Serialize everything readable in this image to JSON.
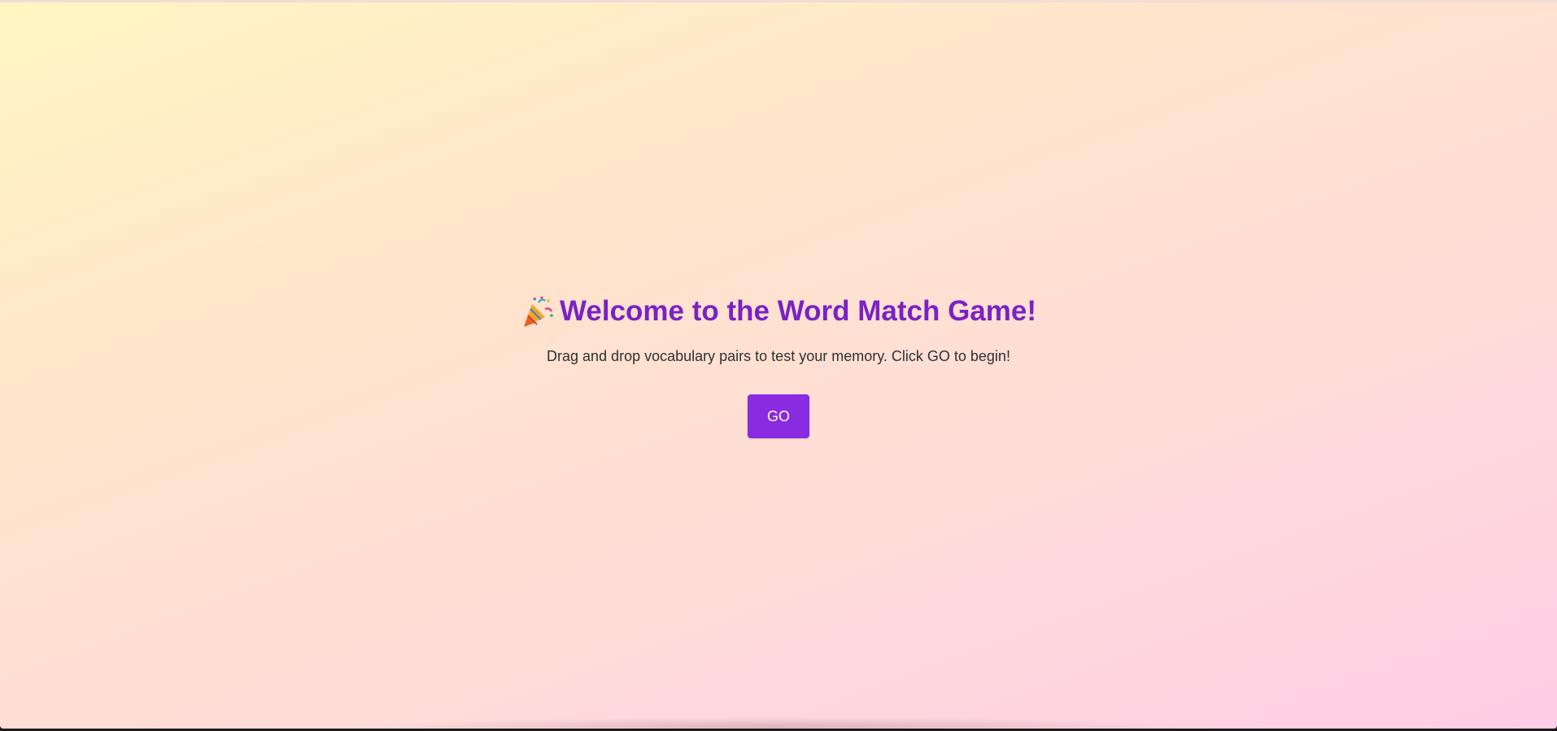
{
  "welcome": {
    "icon": "party-popper-icon",
    "title": "Welcome to the Word Match Game!",
    "subtitle": "Drag and drop vocabulary pairs to test your memory. Click GO to begin!",
    "go_label": "GO"
  },
  "colors": {
    "accent": "#8a2be2",
    "title": "#7a22c4",
    "background_start": "#fff6c2",
    "background_end": "#ffcde6"
  }
}
